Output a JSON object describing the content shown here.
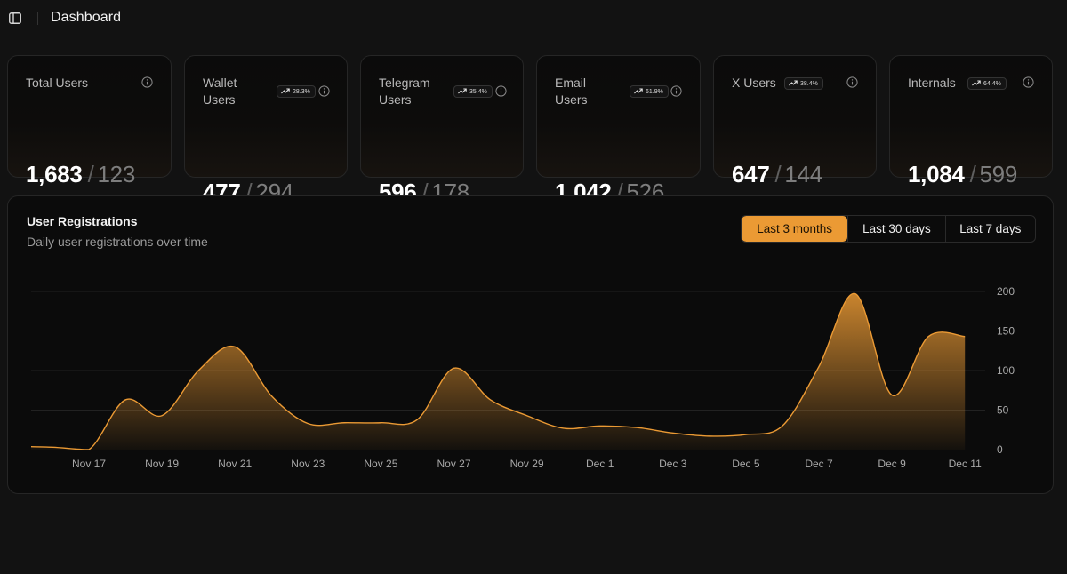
{
  "header": {
    "title": "Dashboard",
    "sidebar_icon": "sidebar-panel-icon"
  },
  "stats": [
    {
      "title": "Total Users",
      "value": "1,683",
      "secondary": "123",
      "badge": null
    },
    {
      "title": "Wallet Users",
      "value": "477",
      "secondary": "294",
      "badge": "28.3%"
    },
    {
      "title": "Telegram Users",
      "value": "596",
      "secondary": "178",
      "badge": "35.4%"
    },
    {
      "title": "Email Users",
      "value": "1,042",
      "secondary": "526",
      "badge": "61.9%"
    },
    {
      "title": "X Users",
      "value": "647",
      "secondary": "144",
      "badge": "38.4%"
    },
    {
      "title": "Internals",
      "value": "1,084",
      "secondary": "599",
      "badge": "64.4%"
    }
  ],
  "stat_separator": "/",
  "registrations": {
    "title": "User Registrations",
    "subtitle": "Daily user registrations over time",
    "ranges": [
      "Last 3 months",
      "Last 30 days",
      "Last 7 days"
    ],
    "active_range": "Last 3 months"
  },
  "colors": {
    "accent": "#eb9a34",
    "background": "#121212",
    "card": "#0b0b0b"
  },
  "chart_data": {
    "type": "area",
    "x": [
      "Nov 15",
      "Nov 16",
      "Nov 17",
      "Nov 18",
      "Nov 19",
      "Nov 20",
      "Nov 21",
      "Nov 22",
      "Nov 23",
      "Nov 24",
      "Nov 25",
      "Nov 26",
      "Nov 27",
      "Nov 28",
      "Nov 29",
      "Nov 30",
      "Dec 1",
      "Dec 2",
      "Dec 3",
      "Dec 4",
      "Dec 5",
      "Dec 6",
      "Dec 7",
      "Dec 8",
      "Dec 9",
      "Dec 10",
      "Dec 11"
    ],
    "series": [
      {
        "values": [
          4,
          3,
          0,
          63,
          43,
          100,
          130,
          68,
          33,
          34,
          34,
          38,
          103,
          63,
          43,
          27,
          30,
          28,
          21,
          17,
          19,
          30,
          105,
          197,
          69,
          143,
          143
        ]
      }
    ],
    "x_ticks": [
      "Nov 17",
      "Nov 19",
      "Nov 21",
      "Nov 23",
      "Nov 25",
      "Nov 27",
      "Nov 29",
      "Dec 1",
      "Dec 3",
      "Dec 5",
      "Dec 7",
      "Dec 9",
      "Dec 11"
    ],
    "y_ticks": [
      0,
      50,
      100,
      150,
      200
    ],
    "ylim": [
      0,
      200
    ],
    "grid": "horizontal",
    "legend": "none"
  }
}
